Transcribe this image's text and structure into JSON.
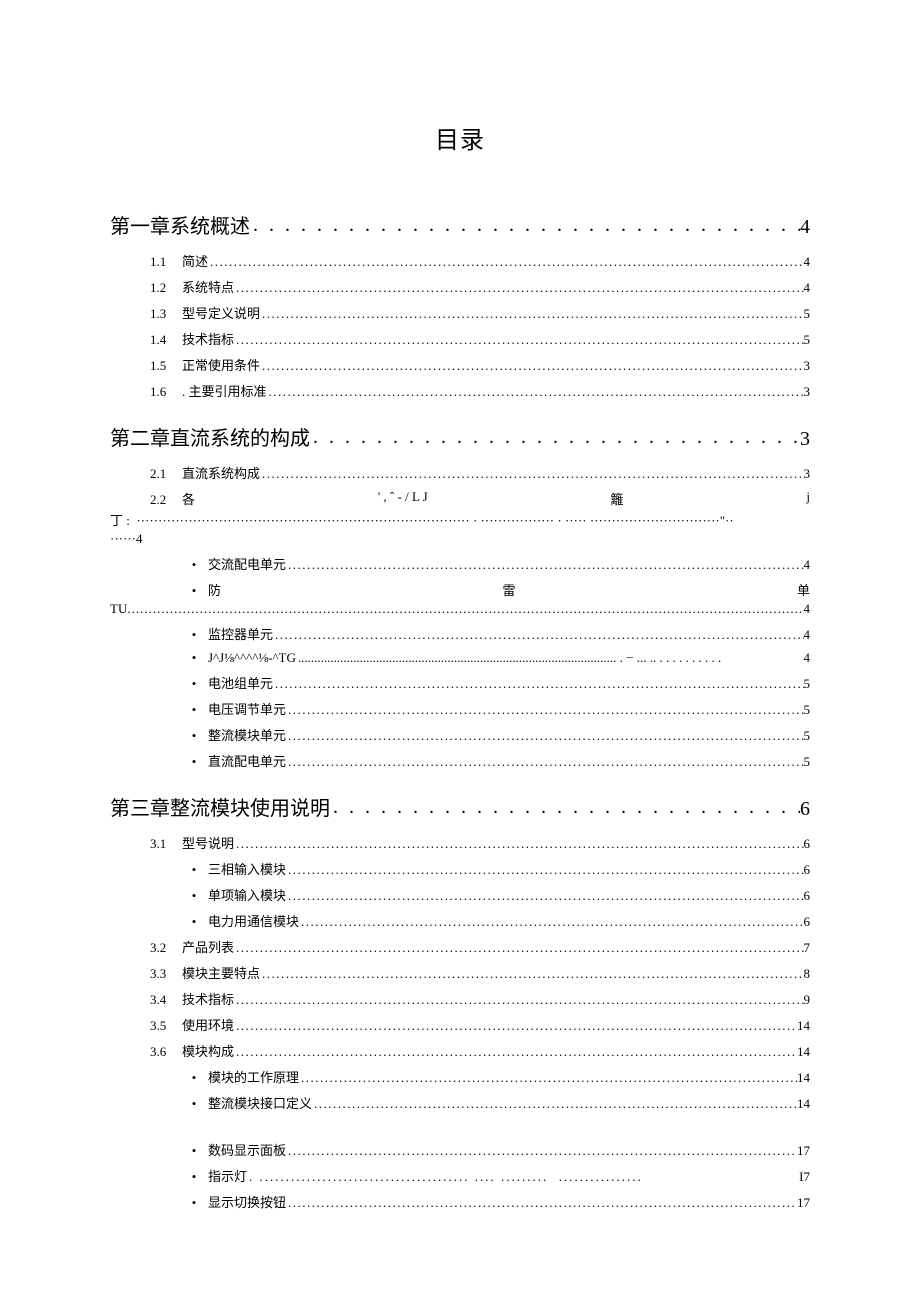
{
  "title": "目录",
  "chapters": [
    {
      "label": "第一章系统概述",
      "page": "4",
      "subs": [
        {
          "num": "1.1",
          "label": "简述",
          "page": "4"
        },
        {
          "num": "1.2",
          "label": "系统特点",
          "page": "4"
        },
        {
          "num": "1.3",
          "label": "型号定义说明",
          "page": "5"
        },
        {
          "num": "1.4",
          "label": "技术指标",
          "page": "5"
        },
        {
          "num": "1.5",
          "label": "正常使用条件",
          "page": "3"
        },
        {
          "num": "1.6",
          "label": ". 主要引用标准",
          "page": "3"
        }
      ]
    },
    {
      "label": "第二章直流系统的构成",
      "page": "3",
      "subs": [
        {
          "num": "2.1",
          "label": "直流系统构成",
          "page": "3"
        }
      ],
      "special_sub": {
        "num": "2.2",
        "parts": [
          "各",
          "' , ˆ - / L J",
          "籬",
          "j"
        ],
        "wrap_prefix": "丁 :",
        "wrap_tail": "4"
      },
      "bullets": [
        {
          "label": "交流配电单元",
          "page": "4"
        }
      ],
      "special_bullet": {
        "parts": [
          "防",
          "雷",
          "单"
        ],
        "wrap_prefix": "TU",
        "wrap_tail": "4"
      },
      "bullets2": [
        {
          "label": "监控器单元",
          "page": "4"
        },
        {
          "label": "J^J⅛^^^^⅛-^TG",
          "page": "4",
          "dashstyle": true
        },
        {
          "label": "电池组单元",
          "page": "5"
        },
        {
          "label": "电压调节单元",
          "page": "5"
        },
        {
          "label": "整流模块单元",
          "page": "5"
        },
        {
          "label": "直流配电单元",
          "page": "5"
        }
      ]
    },
    {
      "label": "第三章整流模块使用说明",
      "page": "6",
      "subs3": [
        {
          "num": "3.1",
          "label": "型号说明",
          "page": "6",
          "bullets": [
            {
              "label": "三相输入模块",
              "page": "6"
            },
            {
              "label": "单项输入模块",
              "page": "6"
            },
            {
              "label": "电力用通信模块",
              "page": "6"
            }
          ]
        },
        {
          "num": "3.2",
          "label": "产品列表",
          "page": "7"
        },
        {
          "num": "3.3",
          "label": "模块主要特点",
          "page": "8"
        },
        {
          "num": "3.4",
          "label": "技术指标",
          "page": "9"
        },
        {
          "num": "3.5",
          "label": "使用环境",
          "page": "14"
        },
        {
          "num": "3.6",
          "label": "模块构成",
          "page": "14",
          "bullets": [
            {
              "label": "模块的工作原理",
              "page": "14"
            },
            {
              "label": "整流模块接口定义",
              "page": "14"
            }
          ],
          "bullets_gap": [
            {
              "label": "数码显示面板",
              "page": "17"
            },
            {
              "label": "指示灯",
              "page": "I7",
              "spaced": true
            },
            {
              "label": "显示切换按钮",
              "page": "17"
            }
          ]
        }
      ]
    }
  ],
  "dots_fill": "................................................................................................................................................................",
  "dots_fill_small": ". . . . . . . . . . . . . . . . . . . . . . . . . . . . . . . . . . . . . . . . . . . . . . . . . . . . . . . . . . . . . . . . . . . . . . . . . . . . . . . ."
}
